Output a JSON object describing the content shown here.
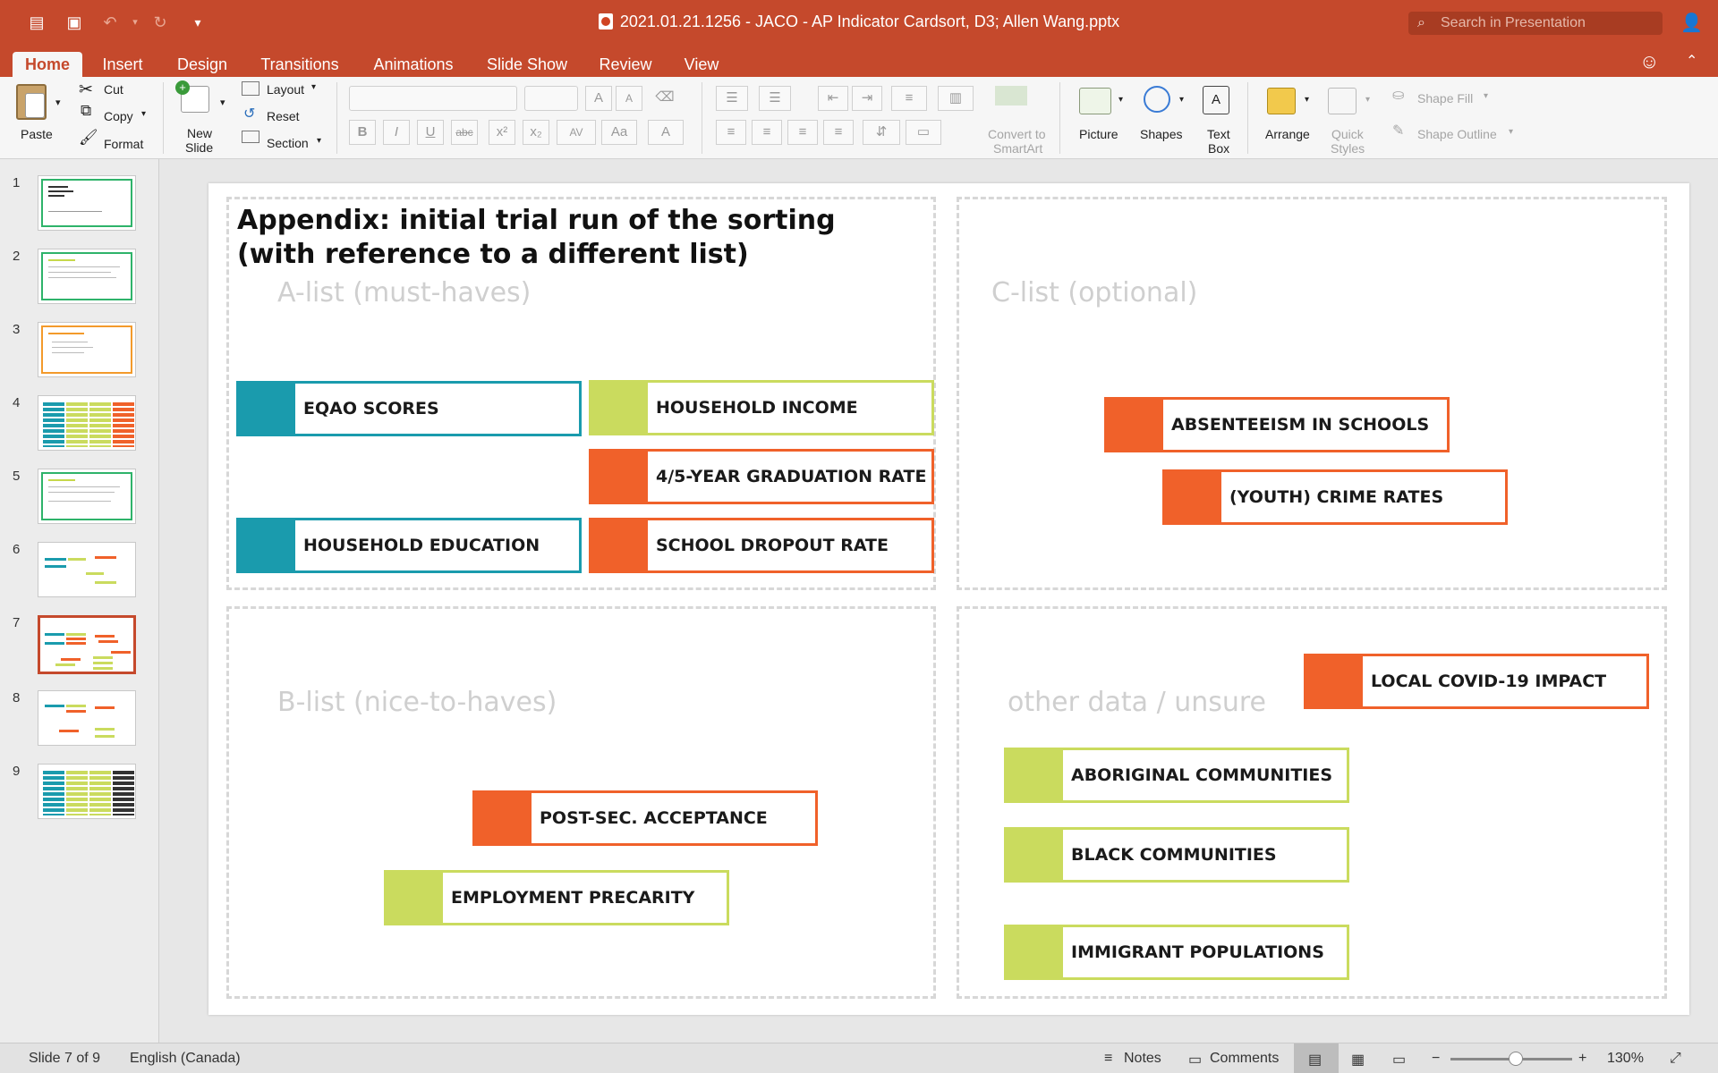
{
  "window": {
    "title": "2021.01.21.1256 - JACO - AP Indicator Cardsort, D3; Allen Wang.pptx",
    "search_placeholder": "Search in Presentation"
  },
  "tabs": [
    "Home",
    "Insert",
    "Design",
    "Transitions",
    "Animations",
    "Slide Show",
    "Review",
    "View"
  ],
  "active_tab": "Home",
  "ribbon": {
    "paste": "Paste",
    "cut": "Cut",
    "copy": "Copy",
    "format": "Format",
    "new_slide_1": "New",
    "new_slide_2": "Slide",
    "layout": "Layout",
    "reset": "Reset",
    "section": "Section",
    "convert_1": "Convert to",
    "convert_2": "SmartArt",
    "picture": "Picture",
    "shapes": "Shapes",
    "textbox_1": "Text",
    "textbox_2": "Box",
    "arrange": "Arrange",
    "quick_1": "Quick",
    "quick_2": "Styles",
    "shape_fill": "Shape Fill",
    "shape_outline": "Shape Outline"
  },
  "thumbnails": [
    "1",
    "2",
    "3",
    "4",
    "5",
    "6",
    "7",
    "8",
    "9"
  ],
  "selected_slide": 7,
  "slide": {
    "title_line1": "Appendix: initial trial run of the sorting",
    "title_line2": "(with reference to a different list)",
    "quadrants": {
      "a": "A-list (must-haves)",
      "b": "B-list (nice-to-haves)",
      "c": "C-list (optional)",
      "d": "other data / unsure"
    },
    "cards": {
      "eqao": "EQAO SCORES",
      "hh_income": "HOUSEHOLD INCOME",
      "grad_rate": "4/5-YEAR GRADUATION RATE",
      "hh_edu": "HOUSEHOLD EDUCATION",
      "dropout": "SCHOOL DROPOUT RATE",
      "absent": "ABSENTEEISM IN SCHOOLS",
      "crime": "(YOUTH) CRIME RATES",
      "postsec": "POST-SEC. ACCEPTANCE",
      "employ": "EMPLOYMENT PRECARITY",
      "covid": "LOCAL COVID-19 IMPACT",
      "aboriginal": "ABORIGINAL COMMUNITIES",
      "black": "BLACK COMMUNITIES",
      "immigrant": "IMMIGRANT POPULATIONS"
    },
    "colors": {
      "teal": "#1a9bad",
      "green": "#cadb5e",
      "orange": "#f0612a"
    }
  },
  "status": {
    "slide_of": "Slide 7 of 9",
    "language": "English (Canada)",
    "notes": "Notes",
    "comments": "Comments",
    "zoom": "130%"
  }
}
